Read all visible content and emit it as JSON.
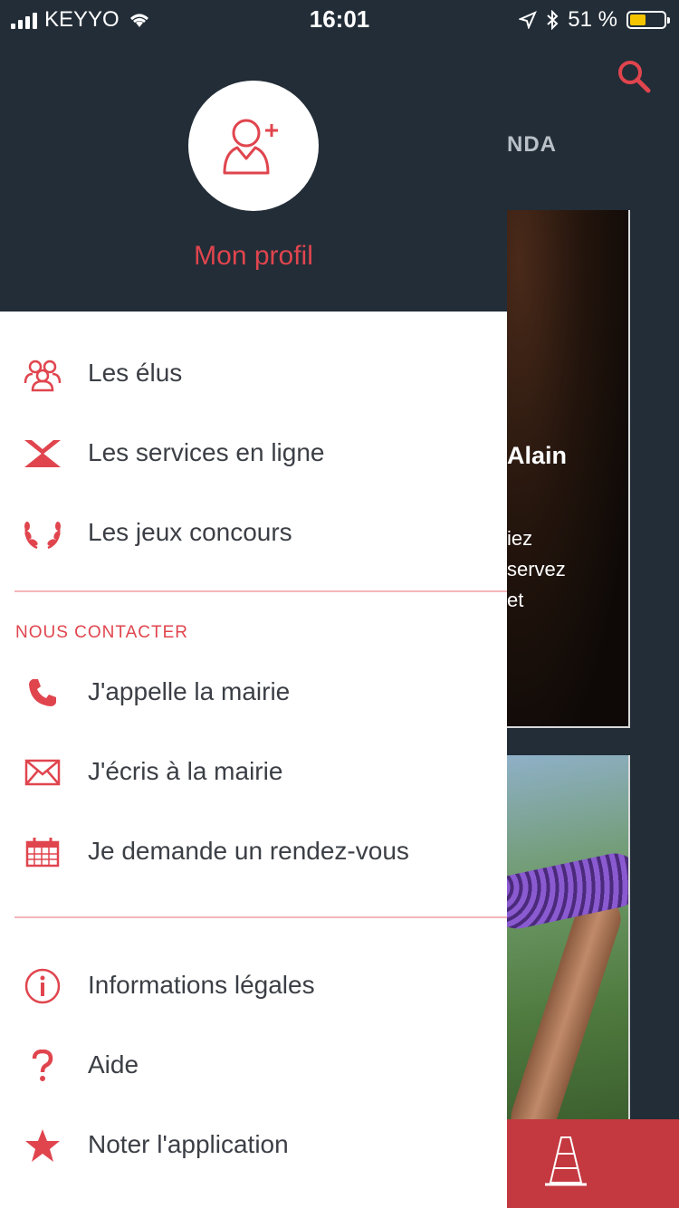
{
  "status_bar": {
    "carrier": "KEYYO",
    "time": "16:01",
    "battery": "51 %",
    "battery_level": 0.51
  },
  "background": {
    "tab_partial": "NDA",
    "card1_title_partial": "Alain",
    "card1_text_partial": "iez\nservez\net"
  },
  "drawer": {
    "profile_label": "Mon profil",
    "items": [
      {
        "label": "Les élus",
        "icon": "people-group-icon"
      },
      {
        "label": "Les services en ligne",
        "icon": "hourglass-icon"
      },
      {
        "label": "Les jeux concours",
        "icon": "laurel-wreath-icon"
      }
    ],
    "contact_section_title": "NOUS CONTACTER",
    "contact_items": [
      {
        "label": "J'appelle la mairie",
        "icon": "phone-icon"
      },
      {
        "label": "J'écris à la mairie",
        "icon": "envelope-icon"
      },
      {
        "label": "Je demande un rendez-vous",
        "icon": "calendar-icon"
      }
    ],
    "footer_items": [
      {
        "label": "Informations légales",
        "icon": "info-icon"
      },
      {
        "label": "Aide",
        "icon": "question-icon"
      },
      {
        "label": "Noter l'application",
        "icon": "star-icon"
      }
    ]
  },
  "colors": {
    "accent": "#e0454e",
    "header_bg": "#222d37",
    "bottom_bar": "#c4383f"
  }
}
